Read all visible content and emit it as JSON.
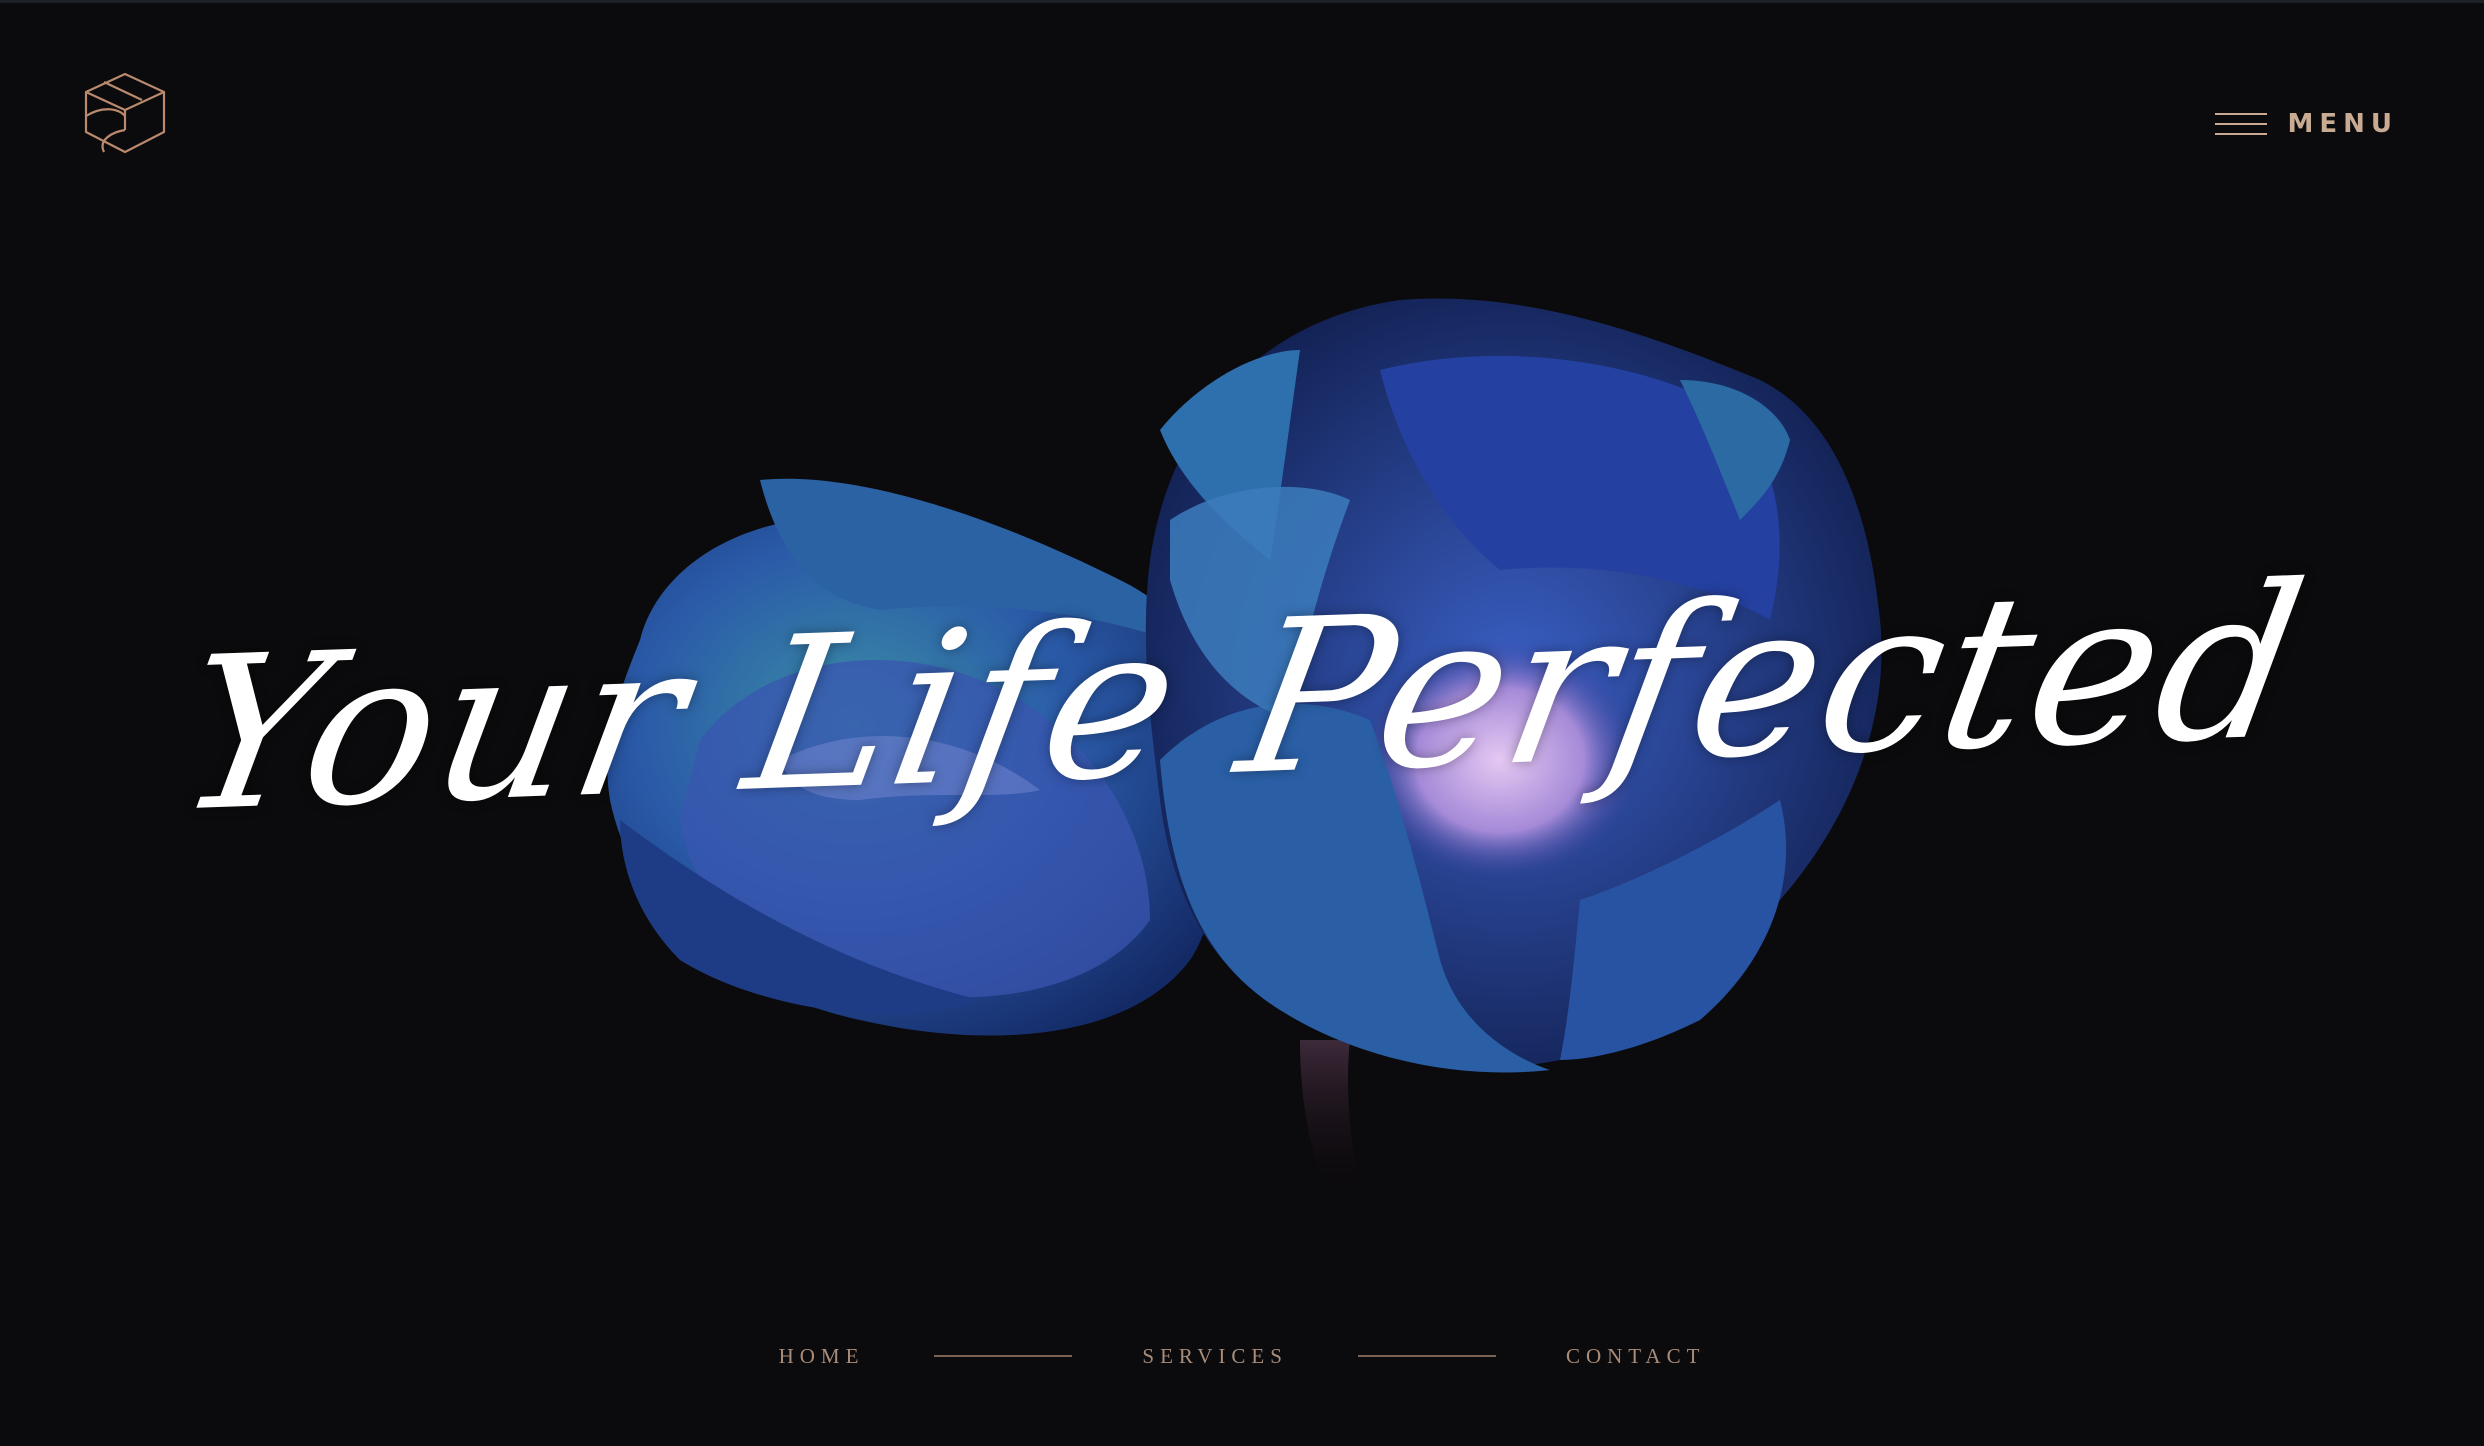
{
  "header": {
    "logo_icon": "cube-logo-icon",
    "menu_icon": "hamburger-menu-icon",
    "menu_label": "MENU"
  },
  "hero": {
    "tagline": "Your Life Perfected",
    "background": "blue-tulip-flowers-image"
  },
  "nav": {
    "items": [
      {
        "label": "HOME"
      },
      {
        "label": "SERVICES"
      },
      {
        "label": "CONTACT"
      }
    ]
  },
  "colors": {
    "background": "#0b0a0c",
    "accent": "#c9ab93",
    "nav_text": "#a88c7a",
    "tagline": "#ffffff"
  }
}
